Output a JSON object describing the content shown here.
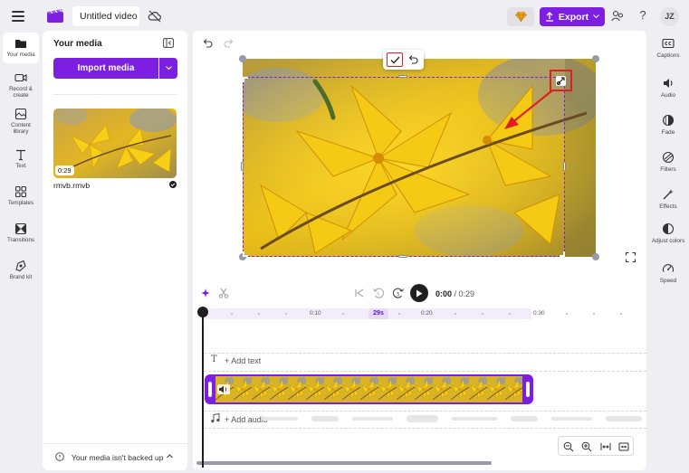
{
  "header": {
    "project_title": "Untitled video",
    "export_label": "Export",
    "user_initials": "JZ",
    "help_symbol": "?"
  },
  "left_nav": {
    "items": [
      {
        "label": "Your media",
        "icon": "folder-icon"
      },
      {
        "label": "Record & create",
        "icon": "camera-icon"
      },
      {
        "label": "Content library",
        "icon": "library-icon"
      },
      {
        "label": "Text",
        "icon": "text-icon"
      },
      {
        "label": "Templates",
        "icon": "templates-icon"
      },
      {
        "label": "Transitions",
        "icon": "transitions-icon"
      },
      {
        "label": "Brand kit",
        "icon": "brand-kit-icon"
      }
    ]
  },
  "media_panel": {
    "title": "Your media",
    "import_label": "Import media",
    "items": [
      {
        "name": "rmvb.rmvb",
        "duration": "0:29"
      }
    ],
    "backup_text": "Your media isn't backed up"
  },
  "right_rail": {
    "items": [
      {
        "label": "Captions",
        "icon": "captions-icon"
      },
      {
        "label": "Audio",
        "icon": "audio-icon"
      },
      {
        "label": "Fade",
        "icon": "fade-icon"
      },
      {
        "label": "Filters",
        "icon": "filters-icon"
      },
      {
        "label": "Effects",
        "icon": "effects-icon"
      },
      {
        "label": "Adjust colors",
        "icon": "adjust-colors-icon"
      },
      {
        "label": "Speed",
        "icon": "speed-icon"
      }
    ]
  },
  "timeline": {
    "current_time": "0:00",
    "total_time": "/ 0:29",
    "playhead_label": "29s",
    "ruler_ticks": [
      "0:10",
      "0:20",
      "0:30"
    ],
    "add_text_label": "+ Add text",
    "add_audio_label": "+ Add audio"
  },
  "colors": {
    "accent": "#7c1fe0",
    "highlight": "#e02020",
    "background": "#efeff3"
  }
}
